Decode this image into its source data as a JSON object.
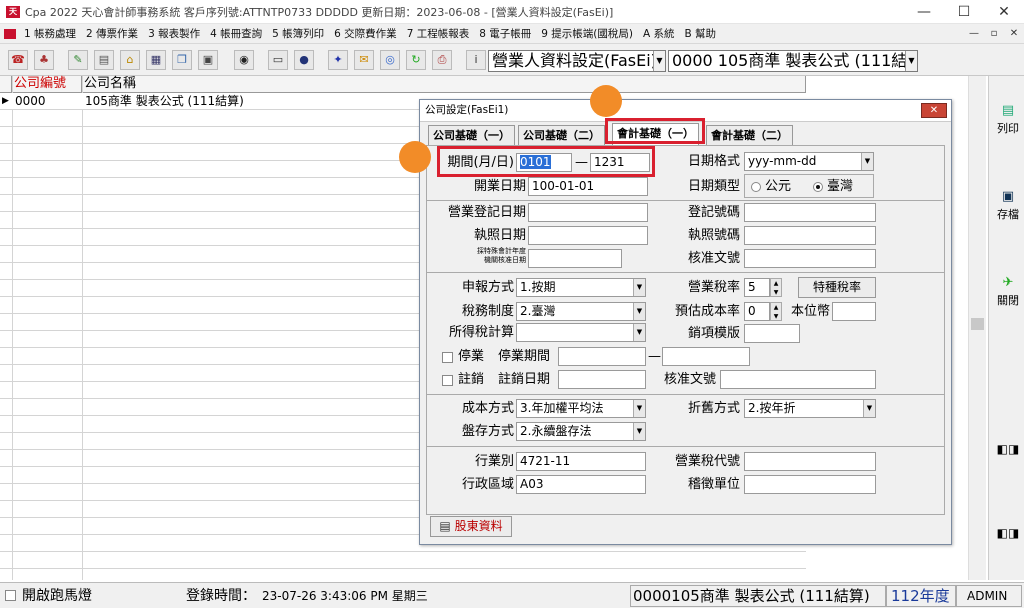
{
  "window": {
    "title": "Cpa 2022  天心會計師事務系統  客戶序列號:ATTNTP0733 DDDDD   更新日期：2023-06-08 - [營業人資料設定(FasEi)]",
    "minimize": "—",
    "maximize": "☐",
    "close": "✕"
  },
  "menu": {
    "items": [
      "1 帳務處理",
      "2 傳票作業",
      "3 報表製作",
      "4 帳冊查詢",
      "5 帳簿列印",
      "6 交際費作業",
      "7 工程帳報表",
      "8 電子帳冊",
      "9 提示帳端(國稅局)",
      "A 系統",
      "B 幫助"
    ],
    "mdi_min": "—",
    "mdi_restore": "▫",
    "mdi_close": "✕"
  },
  "toolbar": {
    "company_combo": "營業人資料設定(FasEi)",
    "company_select": "0000  105商準 製表公式 (111結算)"
  },
  "grid": {
    "headers": [
      "公司編號",
      "公司名稱"
    ],
    "rows": [
      {
        "id": "0000",
        "name": "105商準 製表公式 (111結算)"
      }
    ]
  },
  "right_panel": {
    "print": "列印",
    "save": "存檔",
    "close": "關閉"
  },
  "status": {
    "marquee_label": "開啟跑馬燈",
    "login_label": "登錄時間：",
    "login_time": "23-07-26 3:43:06 PM  星期三",
    "company": "0000105商準 製表公式 (111結算)",
    "year": "112年度",
    "user": "ADMIN"
  },
  "dialog": {
    "title": "公司設定(FasEi1)",
    "close": "✕",
    "tabs": [
      "公司基礎（一）",
      "公司基礎（二）",
      "會計基礎（一）",
      "會計基礎（二）"
    ],
    "active_tab": 2,
    "fields": {
      "period_label": "期間(月/日)",
      "period_from": "0101",
      "period_dash": "—",
      "period_to": "1231",
      "date_format_label": "日期格式",
      "date_format": "yyy-mm-dd",
      "open_date_label": "開業日期",
      "open_date": "100-01-01",
      "date_type_label": "日期類型",
      "date_type_ad": "公元",
      "date_type_roc": "臺灣",
      "biz_reg_date_label": "營業登記日期",
      "reg_no_label": "登記號碼",
      "license_date_label": "執照日期",
      "license_no_label": "執照號碼",
      "special_year_label1": "採特殊會計年度",
      "special_year_label2": "機關核准日期",
      "approval_doc_label": "核准文號",
      "filing_label": "申報方式",
      "filing": "1.按期",
      "vat_rate_label": "營業稅率",
      "vat_rate": "5",
      "special_tax_btn": "特種稅率",
      "tax_system_label": "稅務制度",
      "tax_system": "2.臺灣",
      "est_cost_label": "預估成本率",
      "est_cost": "0",
      "currency_label": "本位幣",
      "income_tax_label": "所得稅計算",
      "sales_template_label": "銷項模版",
      "suspend_label": "停業",
      "suspend_period_label": "停業期間",
      "suspend_dash": "—",
      "cancel_label": "註銷",
      "cancel_date_label": "註銷日期",
      "cancel_doc_label": "核准文號",
      "cost_method_label": "成本方式",
      "cost_method": "3.年加權平均法",
      "depreciation_label": "折舊方式",
      "depreciation": "2.按年折",
      "inventory_label": "盤存方式",
      "inventory": "2.永續盤存法",
      "industry_label": "行業別",
      "industry": "4721-11",
      "vat_code_label": "營業稅代號",
      "district_label": "行政區域",
      "district": "A03",
      "tax_office_label": "稽徵單位"
    },
    "shareholder_btn": "股東資料"
  },
  "colors": {
    "highlight": "#d9202f",
    "marker": "#f28c28"
  }
}
